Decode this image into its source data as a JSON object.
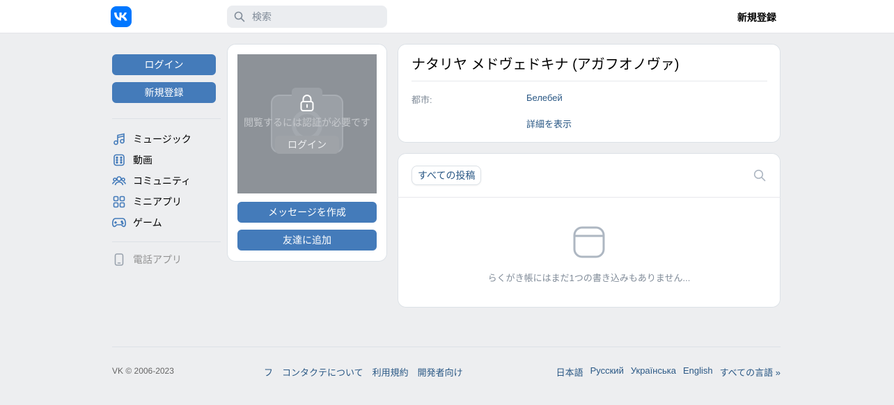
{
  "header": {
    "logo_label": "VK",
    "search_placeholder": "検索",
    "register_label": "新規登録"
  },
  "sidebar": {
    "login_label": "ログイン",
    "register_label": "新規登録",
    "items": [
      {
        "label": "ミュージック",
        "icon": "music-note-icon"
      },
      {
        "label": "動画",
        "icon": "video-icon"
      },
      {
        "label": "コミュニティ",
        "icon": "users-icon"
      },
      {
        "label": "ミニアプリ",
        "icon": "apps-icon"
      },
      {
        "label": "ゲーム",
        "icon": "gamepad-icon"
      }
    ],
    "phone_app_label": "電話アプリ"
  },
  "avatar": {
    "locked_text": "閲覧するには認証が必要です",
    "login_label": "ログイン",
    "message_label": "メッセージを作成",
    "add_friend_label": "友達に追加"
  },
  "profile": {
    "name": "ナタリヤ メドヴェドキナ (アガフオノヴァ)",
    "city_label": "都市:",
    "city_value": "Белебей",
    "more_label": "詳細を表示"
  },
  "posts": {
    "tab_all": "すべての投稿",
    "empty_text": "らくがき帳にはまだ1つの書き込みもありません..."
  },
  "footer": {
    "copyright": "VK © 2006-2023",
    "links": [
      "フ",
      "コンタクテについて",
      "利用規約",
      "開発者向け"
    ],
    "languages": [
      "日本語",
      "Русский",
      "Українська",
      "English",
      "すべての言語 »"
    ]
  },
  "colors": {
    "accent": "#447bba",
    "brand": "#0077ff",
    "link": "#2a5885",
    "background": "#edeef0"
  }
}
